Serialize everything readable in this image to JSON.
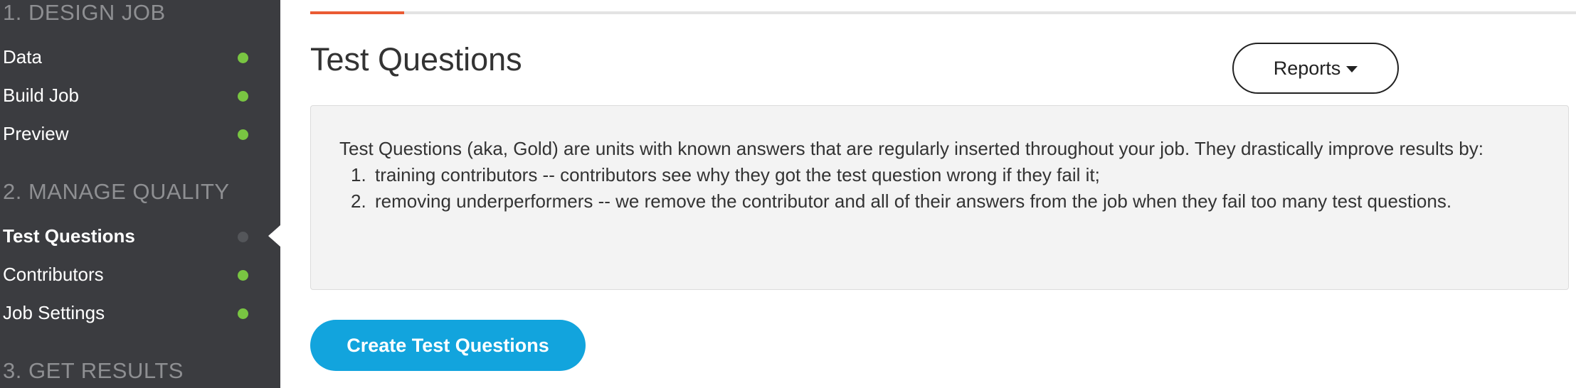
{
  "sidebar": {
    "sections": [
      {
        "title": "1. DESIGN JOB"
      },
      {
        "title": "2. MANAGE QUALITY"
      },
      {
        "title": "3. GET RESULTS"
      }
    ],
    "items": [
      {
        "label": "Data",
        "status": "complete"
      },
      {
        "label": "Build Job",
        "status": "complete"
      },
      {
        "label": "Preview",
        "status": "complete"
      },
      {
        "label": "Test Questions",
        "status": "active"
      },
      {
        "label": "Contributors",
        "status": "complete"
      },
      {
        "label": "Job Settings",
        "status": "complete"
      }
    ],
    "colors": {
      "background": "#3b3c40",
      "complete_dot": "#79c542",
      "inactive_dot": "#54565a"
    }
  },
  "progress": {
    "fraction": 0.074,
    "color": "#ea5b33"
  },
  "main": {
    "title": "Test Questions",
    "reports_label": "Reports",
    "info": {
      "intro": "Test Questions (aka, Gold) are units with known answers that are regularly inserted throughout your job. They drastically improve results by:",
      "points": [
        {
          "num": "1.",
          "text": "training contributors -- contributors see why they got the test question wrong if they fail it;"
        },
        {
          "num": "2.",
          "text": "removing underperformers -- we remove the contributor and all of their answers from the job when they fail too many test questions."
        }
      ]
    },
    "create_label": "Create Test Questions",
    "accent_color": "#12a4dd"
  }
}
